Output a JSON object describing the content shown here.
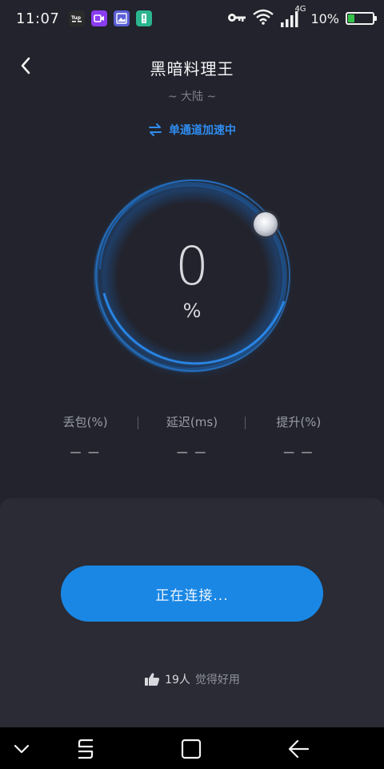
{
  "status_bar": {
    "time": "11:07",
    "network": "4G",
    "battery_text": "10%",
    "battery_level": 0.25,
    "apps": [
      {
        "icon": "tup-app-icon",
        "color": "#2b2b2b",
        "label": "Tup"
      },
      {
        "icon": "video-app-icon",
        "color": "#8a3cf0",
        "label": ""
      },
      {
        "icon": "gallery-app-icon",
        "color": "#5b5fd6",
        "label": ""
      },
      {
        "icon": "alert-app-icon",
        "color": "#2bb58f",
        "label": "!"
      }
    ]
  },
  "header": {
    "title": "黑暗料理王",
    "back_icon": "chevron-left-icon"
  },
  "region": "~ 大陆 ~",
  "mode": {
    "icon": "swap-arrows-icon",
    "label": "单通道加速中"
  },
  "gauge": {
    "value": "0",
    "unit": "%",
    "progress": 0
  },
  "stats": [
    {
      "label": "丢包(%)",
      "value": "— —"
    },
    {
      "label": "延迟(ms)",
      "value": "— —"
    },
    {
      "label": "提升(%)",
      "value": "— —"
    }
  ],
  "connect_button": {
    "label": "正在连接..."
  },
  "likes": {
    "icon": "thumbs-up-icon",
    "count": "19人",
    "text": "觉得好用"
  },
  "navigation": {
    "buttons": [
      "chevron-down-icon",
      "recent-apps-icon",
      "home-icon",
      "back-arrow-icon"
    ]
  },
  "colors": {
    "background": "#22232c",
    "panel": "#2a2b35",
    "accent": "#1a87e4",
    "mode_text": "#2f8cf0",
    "battery": "#35c24a"
  }
}
